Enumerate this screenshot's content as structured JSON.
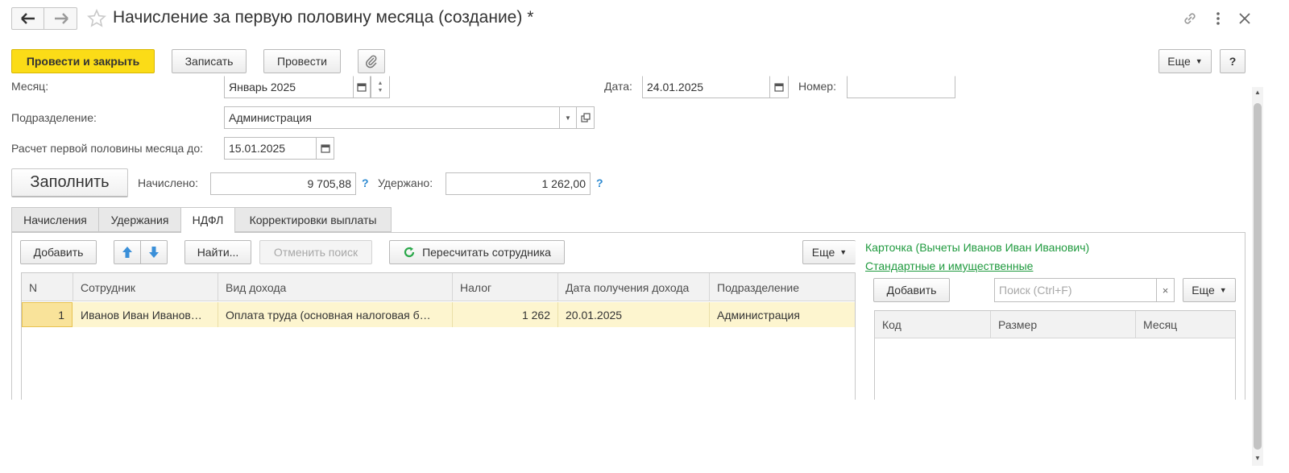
{
  "window": {
    "title": "Начисление за первую половину месяца (создание) *"
  },
  "toolbar": {
    "post_close_label": "Провести и закрыть",
    "save_label": "Записать",
    "post_label": "Провести",
    "more_label": "Еще",
    "help_label": "?"
  },
  "form": {
    "month_label": "Месяц:",
    "month_value": "Январь 2025",
    "date_label": "Дата:",
    "date_value": "24.01.2025",
    "number_label": "Номер:",
    "number_value": "",
    "department_label": "Подразделение:",
    "department_value": "Администрация",
    "calc_until_label": "Расчет первой половины месяца до:",
    "calc_until_value": "15.01.2025",
    "fill_label": "Заполнить",
    "accrued_label": "Начислено:",
    "accrued_value": "9 705,88",
    "withheld_label": "Удержано:",
    "withheld_value": "1 262,00"
  },
  "tabs": [
    {
      "label": "Начисления"
    },
    {
      "label": "Удержания"
    },
    {
      "label": "НДФЛ"
    },
    {
      "label": "Корректировки выплаты"
    }
  ],
  "ndfl": {
    "add_label": "Добавить",
    "find_label": "Найти...",
    "cancel_search_label": "Отменить поиск",
    "recalc_label": "Пересчитать сотрудника",
    "more_label": "Еще",
    "columns": [
      "N",
      "Сотрудник",
      "Вид дохода",
      "Налог",
      "Дата получения дохода",
      "Подразделение"
    ],
    "rows": [
      {
        "n": "1",
        "employee": "Иванов Иван Иванов…",
        "income_type": "Оплата труда (основная налоговая б…",
        "tax": "1 262",
        "income_date": "20.01.2025",
        "department": "Администрация"
      }
    ]
  },
  "card": {
    "title": "Карточка (Вычеты Иванов Иван Иванович)",
    "link": "Стандартные и имущественные",
    "add_label": "Добавить",
    "search_placeholder": "Поиск (Ctrl+F)",
    "more_label": "Еще",
    "columns": [
      "Код",
      "Размер",
      "Месяц"
    ]
  },
  "colors": {
    "primary_button": "#fbdc17",
    "accent_blue": "#2d8ad1",
    "link_green": "#1f9a3e",
    "selected_row": "#fdf5cf"
  }
}
